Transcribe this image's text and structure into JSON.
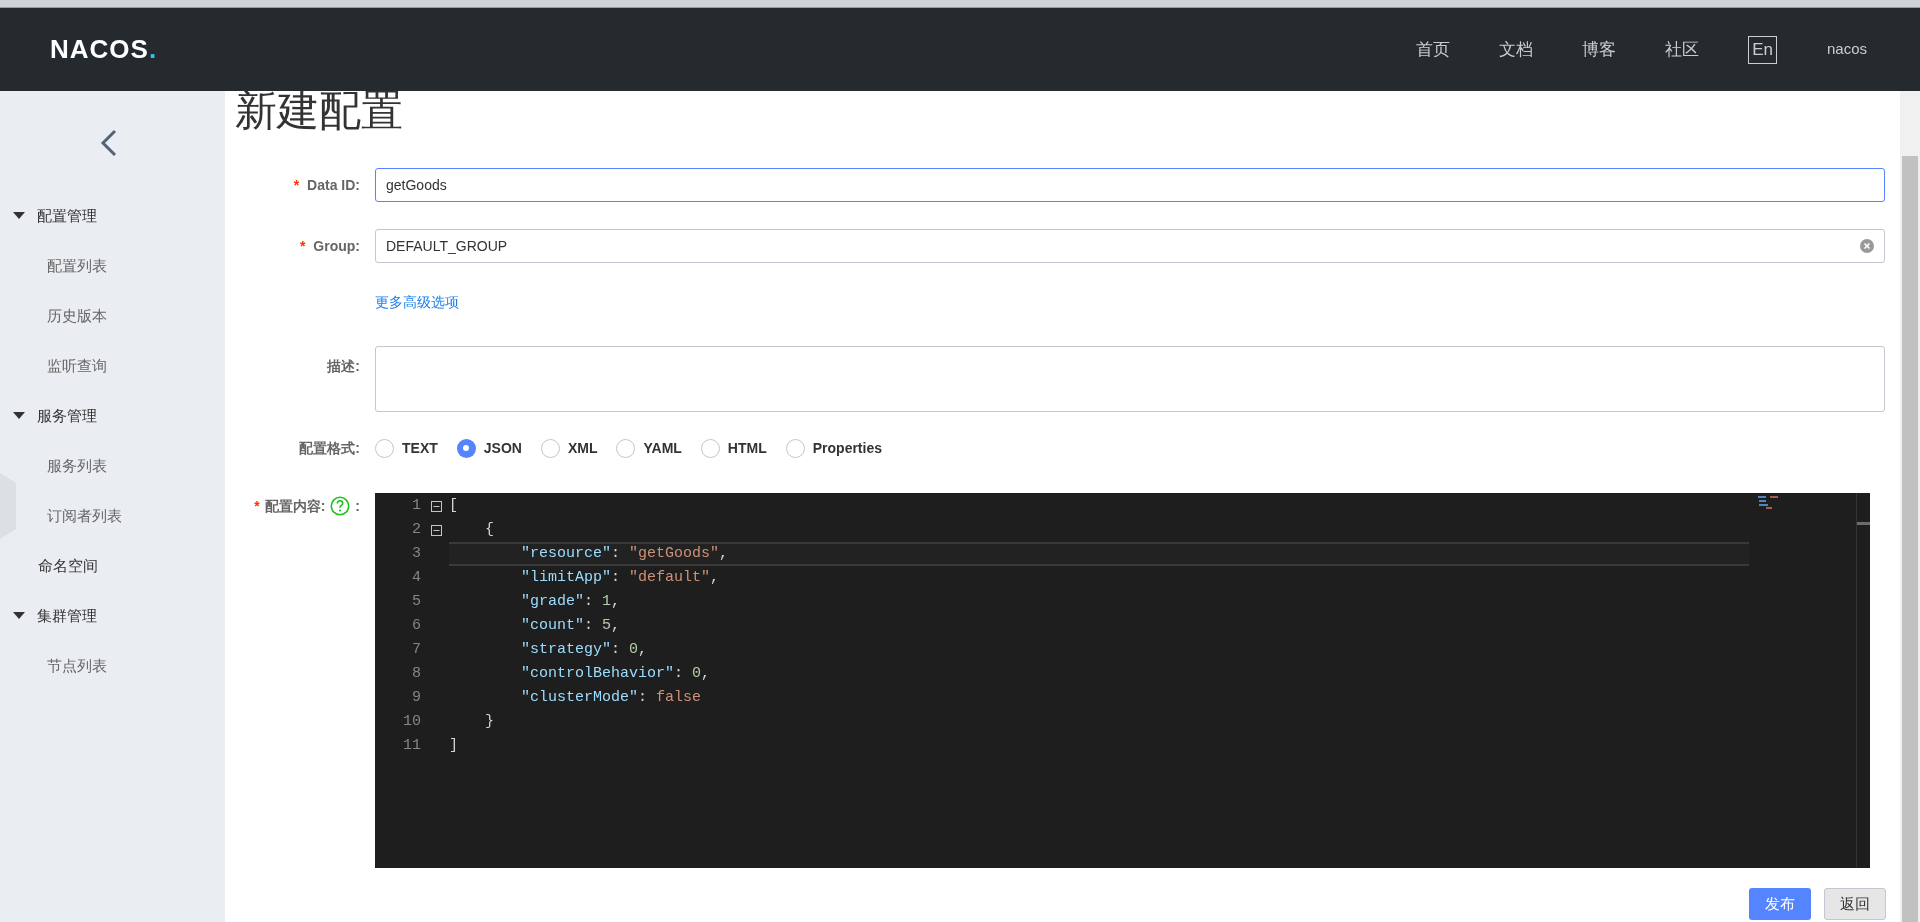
{
  "header": {
    "logo": "NACOS.",
    "nav": [
      {
        "label": "首页"
      },
      {
        "label": "文档"
      },
      {
        "label": "博客"
      },
      {
        "label": "社区"
      }
    ],
    "language": "En",
    "user": "nacos"
  },
  "sidebar": {
    "items": [
      {
        "kind": "group",
        "label": "配置管理",
        "expanded": true,
        "children": [
          {
            "label": "配置列表"
          },
          {
            "label": "历史版本"
          },
          {
            "label": "监听查询"
          }
        ]
      },
      {
        "kind": "group",
        "label": "服务管理",
        "expanded": true,
        "children": [
          {
            "label": "服务列表"
          },
          {
            "label": "订阅者列表"
          }
        ]
      },
      {
        "kind": "link",
        "label": "命名空间"
      },
      {
        "kind": "group",
        "label": "集群管理",
        "expanded": true,
        "children": [
          {
            "label": "节点列表"
          }
        ]
      }
    ]
  },
  "page": {
    "title": "新建配置"
  },
  "form": {
    "data_id": {
      "required_mark": "*",
      "label": "Data ID:",
      "value": "getGoods",
      "focused": true
    },
    "group": {
      "required_mark": "*",
      "label": "Group:",
      "value": "DEFAULT_GROUP"
    },
    "advanced_link": "更多高级选项",
    "description": {
      "label": "描述:"
    },
    "format": {
      "label": "配置格式:",
      "options": [
        {
          "label": "TEXT",
          "selected": false
        },
        {
          "label": "JSON",
          "selected": true
        },
        {
          "label": "XML",
          "selected": false
        },
        {
          "label": "YAML",
          "selected": false
        },
        {
          "label": "HTML",
          "selected": false
        },
        {
          "label": "Properties",
          "selected": false
        }
      ]
    },
    "content": {
      "required_mark": "*",
      "label": "配置内容:",
      "colon": ":",
      "lines": [
        {
          "number": "1",
          "fold": true,
          "current": false,
          "tokens": [
            {
              "kind": "punct",
              "text": "["
            }
          ]
        },
        {
          "number": "2",
          "fold": true,
          "current": false,
          "tokens": [
            {
              "kind": "punct",
              "text": "    {"
            }
          ]
        },
        {
          "number": "3",
          "fold": false,
          "current": true,
          "tokens": [
            {
              "kind": "key",
              "text": "        \"resource\""
            },
            {
              "kind": "punct",
              "text": ": "
            },
            {
              "kind": "string",
              "text": "\"getGoods\""
            },
            {
              "kind": "punct",
              "text": ","
            }
          ]
        },
        {
          "number": "4",
          "fold": false,
          "current": false,
          "tokens": [
            {
              "kind": "key",
              "text": "        \"limitApp\""
            },
            {
              "kind": "punct",
              "text": ": "
            },
            {
              "kind": "string",
              "text": "\"default\""
            },
            {
              "kind": "punct",
              "text": ","
            }
          ]
        },
        {
          "number": "5",
          "fold": false,
          "current": false,
          "tokens": [
            {
              "kind": "key",
              "text": "        \"grade\""
            },
            {
              "kind": "punct",
              "text": ": "
            },
            {
              "kind": "number",
              "text": "1"
            },
            {
              "kind": "punct",
              "text": ","
            }
          ]
        },
        {
          "number": "6",
          "fold": false,
          "current": false,
          "tokens": [
            {
              "kind": "key",
              "text": "        \"count\""
            },
            {
              "kind": "punct",
              "text": ": "
            },
            {
              "kind": "number",
              "text": "5"
            },
            {
              "kind": "punct",
              "text": ","
            }
          ]
        },
        {
          "number": "7",
          "fold": false,
          "current": false,
          "tokens": [
            {
              "kind": "key",
              "text": "        \"strategy\""
            },
            {
              "kind": "punct",
              "text": ": "
            },
            {
              "kind": "number",
              "text": "0"
            },
            {
              "kind": "punct",
              "text": ","
            }
          ]
        },
        {
          "number": "8",
          "fold": false,
          "current": false,
          "tokens": [
            {
              "kind": "key",
              "text": "        \"controlBehavior\""
            },
            {
              "kind": "punct",
              "text": ": "
            },
            {
              "kind": "number",
              "text": "0"
            },
            {
              "kind": "punct",
              "text": ","
            }
          ]
        },
        {
          "number": "9",
          "fold": false,
          "current": false,
          "tokens": [
            {
              "kind": "key",
              "text": "        \"clusterMode\""
            },
            {
              "kind": "punct",
              "text": ": "
            },
            {
              "kind": "bool",
              "text": "false"
            }
          ]
        },
        {
          "number": "10",
          "fold": false,
          "current": false,
          "tokens": [
            {
              "kind": "punct",
              "text": "    }"
            }
          ]
        },
        {
          "number": "11",
          "fold": false,
          "current": false,
          "tokens": [
            {
              "kind": "punct",
              "text": "]"
            }
          ]
        }
      ]
    }
  },
  "buttons": [
    {
      "kind": "primary",
      "label": "发布"
    },
    {
      "kind": "secondary",
      "label": "返回"
    }
  ]
}
